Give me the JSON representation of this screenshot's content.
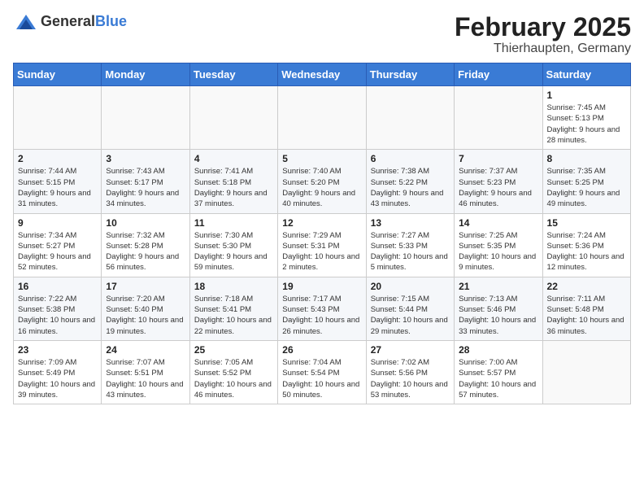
{
  "logo": {
    "text_general": "General",
    "text_blue": "Blue"
  },
  "title": {
    "month": "February 2025",
    "location": "Thierhaupten, Germany"
  },
  "weekdays": [
    "Sunday",
    "Monday",
    "Tuesday",
    "Wednesday",
    "Thursday",
    "Friday",
    "Saturday"
  ],
  "weeks": [
    [
      {
        "day": "",
        "info": ""
      },
      {
        "day": "",
        "info": ""
      },
      {
        "day": "",
        "info": ""
      },
      {
        "day": "",
        "info": ""
      },
      {
        "day": "",
        "info": ""
      },
      {
        "day": "",
        "info": ""
      },
      {
        "day": "1",
        "info": "Sunrise: 7:45 AM\nSunset: 5:13 PM\nDaylight: 9 hours and 28 minutes."
      }
    ],
    [
      {
        "day": "2",
        "info": "Sunrise: 7:44 AM\nSunset: 5:15 PM\nDaylight: 9 hours and 31 minutes."
      },
      {
        "day": "3",
        "info": "Sunrise: 7:43 AM\nSunset: 5:17 PM\nDaylight: 9 hours and 34 minutes."
      },
      {
        "day": "4",
        "info": "Sunrise: 7:41 AM\nSunset: 5:18 PM\nDaylight: 9 hours and 37 minutes."
      },
      {
        "day": "5",
        "info": "Sunrise: 7:40 AM\nSunset: 5:20 PM\nDaylight: 9 hours and 40 minutes."
      },
      {
        "day": "6",
        "info": "Sunrise: 7:38 AM\nSunset: 5:22 PM\nDaylight: 9 hours and 43 minutes."
      },
      {
        "day": "7",
        "info": "Sunrise: 7:37 AM\nSunset: 5:23 PM\nDaylight: 9 hours and 46 minutes."
      },
      {
        "day": "8",
        "info": "Sunrise: 7:35 AM\nSunset: 5:25 PM\nDaylight: 9 hours and 49 minutes."
      }
    ],
    [
      {
        "day": "9",
        "info": "Sunrise: 7:34 AM\nSunset: 5:27 PM\nDaylight: 9 hours and 52 minutes."
      },
      {
        "day": "10",
        "info": "Sunrise: 7:32 AM\nSunset: 5:28 PM\nDaylight: 9 hours and 56 minutes."
      },
      {
        "day": "11",
        "info": "Sunrise: 7:30 AM\nSunset: 5:30 PM\nDaylight: 9 hours and 59 minutes."
      },
      {
        "day": "12",
        "info": "Sunrise: 7:29 AM\nSunset: 5:31 PM\nDaylight: 10 hours and 2 minutes."
      },
      {
        "day": "13",
        "info": "Sunrise: 7:27 AM\nSunset: 5:33 PM\nDaylight: 10 hours and 5 minutes."
      },
      {
        "day": "14",
        "info": "Sunrise: 7:25 AM\nSunset: 5:35 PM\nDaylight: 10 hours and 9 minutes."
      },
      {
        "day": "15",
        "info": "Sunrise: 7:24 AM\nSunset: 5:36 PM\nDaylight: 10 hours and 12 minutes."
      }
    ],
    [
      {
        "day": "16",
        "info": "Sunrise: 7:22 AM\nSunset: 5:38 PM\nDaylight: 10 hours and 16 minutes."
      },
      {
        "day": "17",
        "info": "Sunrise: 7:20 AM\nSunset: 5:40 PM\nDaylight: 10 hours and 19 minutes."
      },
      {
        "day": "18",
        "info": "Sunrise: 7:18 AM\nSunset: 5:41 PM\nDaylight: 10 hours and 22 minutes."
      },
      {
        "day": "19",
        "info": "Sunrise: 7:17 AM\nSunset: 5:43 PM\nDaylight: 10 hours and 26 minutes."
      },
      {
        "day": "20",
        "info": "Sunrise: 7:15 AM\nSunset: 5:44 PM\nDaylight: 10 hours and 29 minutes."
      },
      {
        "day": "21",
        "info": "Sunrise: 7:13 AM\nSunset: 5:46 PM\nDaylight: 10 hours and 33 minutes."
      },
      {
        "day": "22",
        "info": "Sunrise: 7:11 AM\nSunset: 5:48 PM\nDaylight: 10 hours and 36 minutes."
      }
    ],
    [
      {
        "day": "23",
        "info": "Sunrise: 7:09 AM\nSunset: 5:49 PM\nDaylight: 10 hours and 39 minutes."
      },
      {
        "day": "24",
        "info": "Sunrise: 7:07 AM\nSunset: 5:51 PM\nDaylight: 10 hours and 43 minutes."
      },
      {
        "day": "25",
        "info": "Sunrise: 7:05 AM\nSunset: 5:52 PM\nDaylight: 10 hours and 46 minutes."
      },
      {
        "day": "26",
        "info": "Sunrise: 7:04 AM\nSunset: 5:54 PM\nDaylight: 10 hours and 50 minutes."
      },
      {
        "day": "27",
        "info": "Sunrise: 7:02 AM\nSunset: 5:56 PM\nDaylight: 10 hours and 53 minutes."
      },
      {
        "day": "28",
        "info": "Sunrise: 7:00 AM\nSunset: 5:57 PM\nDaylight: 10 hours and 57 minutes."
      },
      {
        "day": "",
        "info": ""
      }
    ]
  ]
}
